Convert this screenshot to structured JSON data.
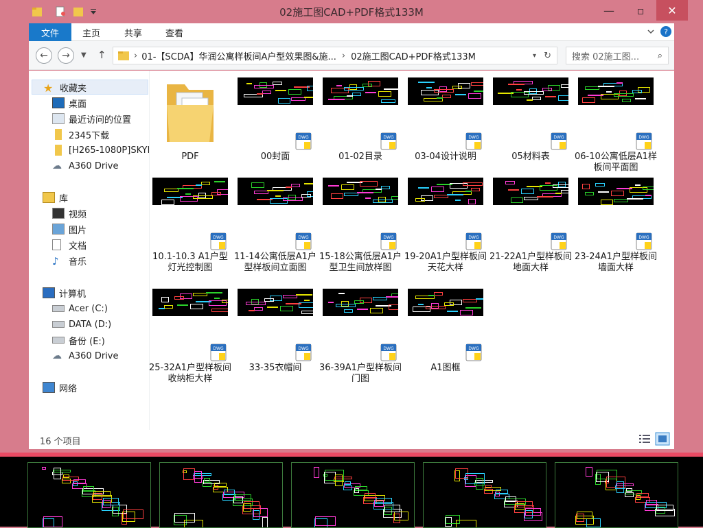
{
  "window": {
    "title": "02施工图CAD+PDF格式133M",
    "minimize_icon": "minimize-icon",
    "maximize_icon": "maximize-icon",
    "close_icon": "close-icon"
  },
  "ribbon": {
    "tabs": [
      "文件",
      "主页",
      "共享",
      "查看"
    ],
    "help_icon": "help-icon",
    "expand_icon": "chevron-down-icon"
  },
  "address": {
    "crumbs": [
      "01-【SCDA】华润公寓样板间A户型效果图&施...",
      "02施工图CAD+PDF格式133M"
    ],
    "search_placeholder": "搜索 02施工图..."
  },
  "nav": {
    "favorites_header": "收藏夹",
    "favorites": [
      "桌面",
      "最近访问的位置",
      "2345下载",
      "[H265-1080P]SKYF",
      "A360 Drive"
    ],
    "library_header": "库",
    "library": [
      "视频",
      "图片",
      "文档",
      "音乐"
    ],
    "computer_header": "计算机",
    "computer": [
      "Acer (C:)",
      "DATA (D:)",
      "备份 (E:)",
      "A360 Drive"
    ],
    "network": "网络"
  },
  "files": [
    {
      "name": "PDF",
      "kind": "folder"
    },
    {
      "name": "00封面",
      "kind": "dwg"
    },
    {
      "name": "01-02目录",
      "kind": "dwg"
    },
    {
      "name": "03-04设计说明",
      "kind": "dwg"
    },
    {
      "name": "05材料表",
      "kind": "dwg"
    },
    {
      "name": "06-10公寓低层A1样板间平面图",
      "kind": "dwg"
    },
    {
      "name": "10.1-10.3 A1户型灯光控制图",
      "kind": "dwg"
    },
    {
      "name": "11-14公寓低层A1户型样板间立面图",
      "kind": "dwg"
    },
    {
      "name": "15-18公寓低层A1户型卫生间放样图",
      "kind": "dwg"
    },
    {
      "name": "19-20A1户型样板间天花大样",
      "kind": "dwg"
    },
    {
      "name": "21-22A1户型样板间地面大样",
      "kind": "dwg"
    },
    {
      "name": "23-24A1户型样板间墙面大样",
      "kind": "dwg"
    },
    {
      "name": "25-32A1户型样板间收纳柜大样",
      "kind": "dwg"
    },
    {
      "name": "33-35衣帽间",
      "kind": "dwg"
    },
    {
      "name": "36-39A1户型样板间门图",
      "kind": "dwg"
    },
    {
      "name": "A1图框",
      "kind": "dwg"
    }
  ],
  "dwg_badge": "DWG",
  "status": {
    "count": "16 个项目"
  },
  "colors": {
    "frame": "#d77c8c",
    "accent": "#1979ca",
    "cad_bg": "#000000"
  }
}
